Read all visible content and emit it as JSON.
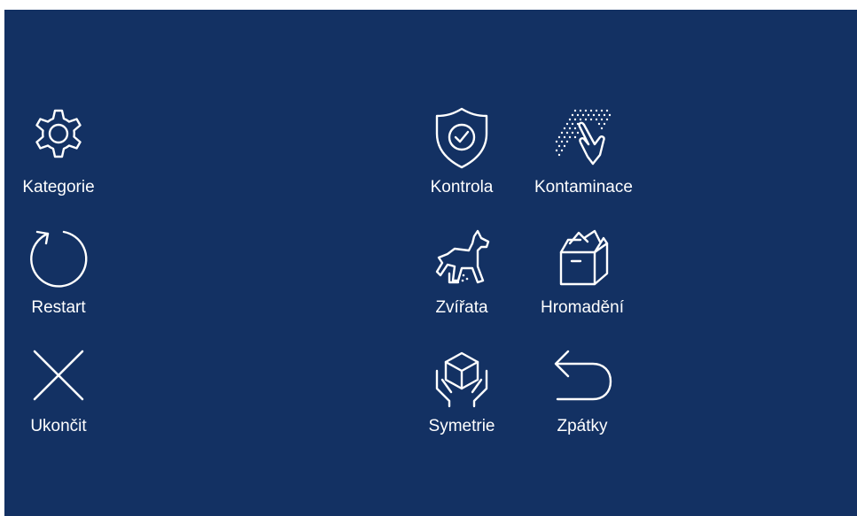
{
  "left_menu": {
    "items": [
      {
        "label": "Kategorie",
        "icon": "gear-icon"
      },
      {
        "label": "Restart",
        "icon": "restart-icon"
      },
      {
        "label": "Ukončit",
        "icon": "close-icon"
      }
    ]
  },
  "right_menu": {
    "items": [
      {
        "label": "Kontrola",
        "icon": "shield-check-icon"
      },
      {
        "label": "Kontaminace",
        "icon": "hand-contamination-icon"
      },
      {
        "label": "Zvířata",
        "icon": "dog-icon"
      },
      {
        "label": "Hromadění",
        "icon": "open-box-icon"
      },
      {
        "label": "Symetrie",
        "icon": "hands-cube-icon"
      },
      {
        "label": "Zpátky",
        "icon": "back-arrow-icon"
      }
    ]
  },
  "colors": {
    "background": "#133163",
    "foreground": "#ffffff"
  }
}
